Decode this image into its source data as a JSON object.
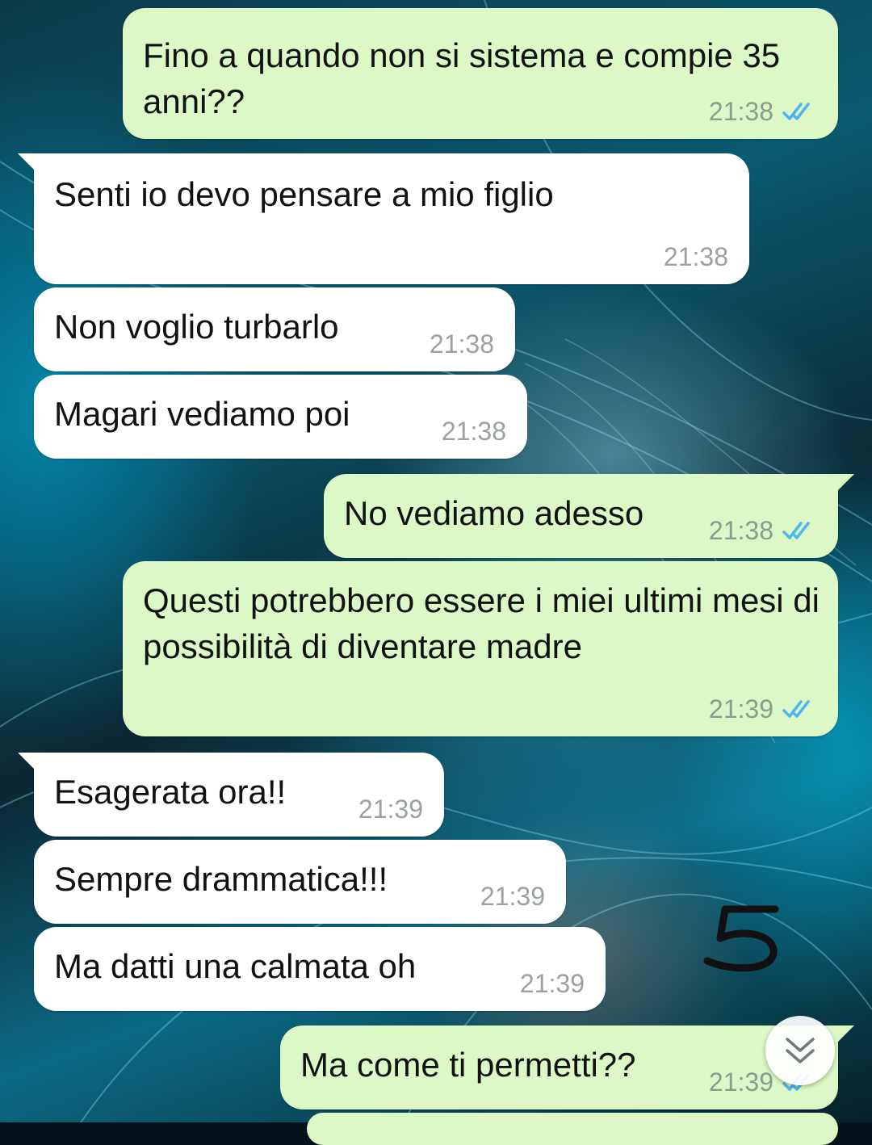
{
  "chat": {
    "messages": [
      {
        "direction": "out",
        "text": "Fino a quando non si sistema e compie 35 anni??",
        "time": "21:38",
        "status": "read"
      },
      {
        "direction": "in",
        "text": "Senti io devo pensare a mio figlio",
        "time": "21:38"
      },
      {
        "direction": "in",
        "text": "Non voglio turbarlo",
        "time": "21:38"
      },
      {
        "direction": "in",
        "text": "Magari vediamo poi",
        "time": "21:38"
      },
      {
        "direction": "out",
        "text": "No vediamo adesso",
        "time": "21:38",
        "status": "read"
      },
      {
        "direction": "out",
        "text": "Questi potrebbero essere i miei ultimi mesi di possibilità di diventare madre",
        "time": "21:39",
        "status": "read"
      },
      {
        "direction": "in",
        "text": "Esagerata ora!!",
        "time": "21:39"
      },
      {
        "direction": "in",
        "text": "Sempre drammatica!!!",
        "time": "21:39"
      },
      {
        "direction": "in",
        "text": "Ma datti una calmata oh",
        "time": "21:39"
      },
      {
        "direction": "out",
        "text": "Ma come ti permetti??",
        "time": "21:39",
        "status": "read"
      }
    ]
  },
  "annotation": {
    "text": "5"
  },
  "colors": {
    "outgoing_bubble": "#dcf8c6",
    "incoming_bubble": "#ffffff",
    "read_tick": "#4fb6ec"
  },
  "icons": {
    "read_receipt": "double-check-icon",
    "scroll_button": "chevron-double-down-icon"
  }
}
